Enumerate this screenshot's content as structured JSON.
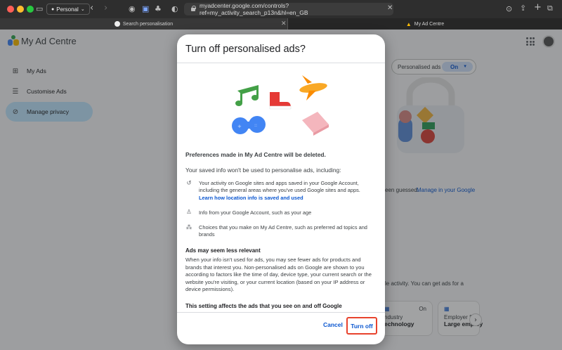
{
  "browser": {
    "profile_label": "Personal",
    "url": "myadcenter.google.com/controls?ref=my_activity_search_p13n&hl=en_GB",
    "tabs": [
      {
        "label": "Search personalisation"
      },
      {
        "label": "My Ad Centre"
      }
    ]
  },
  "app": {
    "title": "My Ad Centre",
    "nav": [
      {
        "label": "My Ads",
        "icon": "ads-icon"
      },
      {
        "label": "Customise Ads",
        "icon": "tune-icon"
      },
      {
        "label": "Manage privacy",
        "icon": "privacy-icon",
        "active": true
      }
    ],
    "personalised_ads_label": "Personalised ads",
    "personalised_ads_value": "On",
    "bg_text_1": "een guessed.",
    "bg_link_1": "Manage in your Google",
    "bg_text_2": "le activity. You can get ads for a",
    "cards": [
      {
        "top": "ndustry",
        "status": "On",
        "title": "echnology"
      },
      {
        "top": "Employer S",
        "title": "Large employ"
      }
    ]
  },
  "dialog": {
    "title": "Turn off personalised ads?",
    "heading": "Preferences made in My Ad Centre will be deleted.",
    "intro": "Your saved info won't be used to personalise ads, including:",
    "items": [
      {
        "icon": "history-icon",
        "text": "Your activity on Google sites and apps saved in your Google Account, including the general areas where you've used Google sites and apps.",
        "link": "Learn how location info is saved and used"
      },
      {
        "icon": "person-icon",
        "text": "Info from your Google Account, such as your age"
      },
      {
        "icon": "hierarchy-icon",
        "text": "Choices that you make on My Ad Centre, such as preferred ad topics and brands"
      }
    ],
    "section1_title": "Ads may seem less relevant",
    "section1_body": "When your info isn't used for ads, you may see fewer ads for products and brands that interest you. Non-personalised ads on Google are shown to you according to factors like the time of day, device type, your current search or the website you're visiting, or your current location (based on your IP address or device permissions).",
    "section2_title": "This setting affects the ads that you see on and off Google",
    "cancel_label": "Cancel",
    "turnoff_label": "Turn off"
  },
  "colors": {
    "accent": "#0b57d0",
    "highlight_border": "#e8432d",
    "active_nav": "#c2e7ff"
  }
}
